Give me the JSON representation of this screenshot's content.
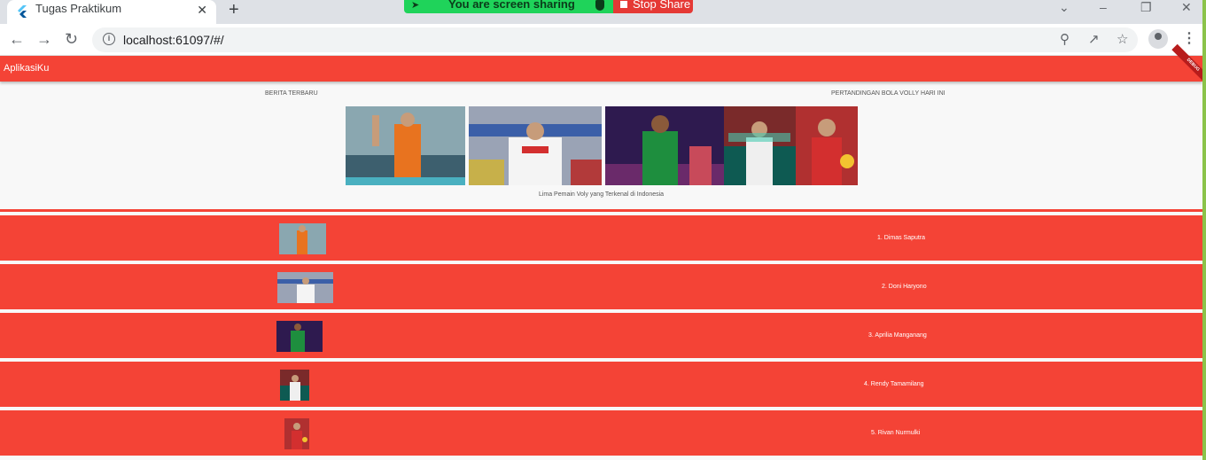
{
  "browser": {
    "tab_title": "Tugas Praktikum",
    "tab_close": "✕",
    "new_tab": "+",
    "url": "localhost:61097/#/",
    "share_text": "You are screen sharing",
    "stop_share": "Stop Share"
  },
  "app": {
    "title": "AplikasiKu",
    "debug_label": "DEBUG",
    "colors": {
      "primary": "#f44336",
      "share_green": "#1fd35a",
      "stop_red": "#e53935"
    }
  },
  "header": {
    "left_label": "BERITA TERBARU",
    "right_label": "PERTANDINGAN BOLA VOLLY HARI INI",
    "caption": "Lima Pemain Voly yang Terkenal di Indonesia"
  },
  "players": [
    {
      "label": "1. Dimas Saputra"
    },
    {
      "label": "2. Doni Haryono"
    },
    {
      "label": "3. Aprilia Manganang"
    },
    {
      "label": "4. Rendy Tamamilang"
    },
    {
      "label": "5. Rivan Nurmulki"
    }
  ]
}
